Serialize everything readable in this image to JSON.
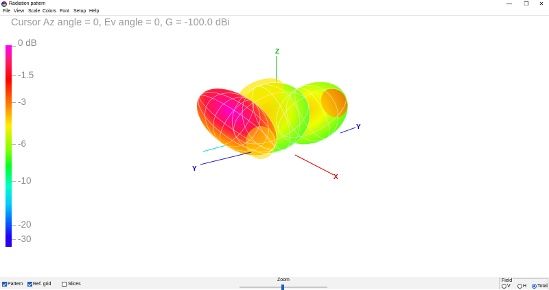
{
  "window": {
    "title": "Radiation pattern",
    "minimize_glyph": "—",
    "maximize_glyph": "❐",
    "close_glyph": "✕"
  },
  "menu": [
    "File",
    "View",
    "Scale",
    "Colors",
    "Font",
    "Setup",
    "Help"
  ],
  "cursor_readout": "Cursor Az angle = 0,  Ev angle = 0,  G = -100.0 dBi",
  "colorbar": {
    "labels": [
      "0 dB",
      "-1.5",
      "-3",
      "-6",
      "-10",
      "-20",
      "-30"
    ]
  },
  "axes": {
    "z_label": "Z",
    "x_label": "X",
    "y_label": "Y",
    "y_neg_label": "Y",
    "colors": {
      "z": "#00b000",
      "x": "#e00000",
      "y": "#0000d0",
      "ref": "#00d0e0"
    }
  },
  "bottom": {
    "pattern": {
      "label": "Pattern",
      "checked": true
    },
    "ref_grid": {
      "label": "Ref. grid",
      "checked": true
    },
    "slices": {
      "label": "Slices",
      "checked": false
    },
    "zoom_label": "Zoom",
    "field_title": "Field",
    "field_options": [
      {
        "label": "V",
        "selected": false
      },
      {
        "label": "H",
        "selected": false
      },
      {
        "label": "Total",
        "selected": true
      }
    ]
  }
}
